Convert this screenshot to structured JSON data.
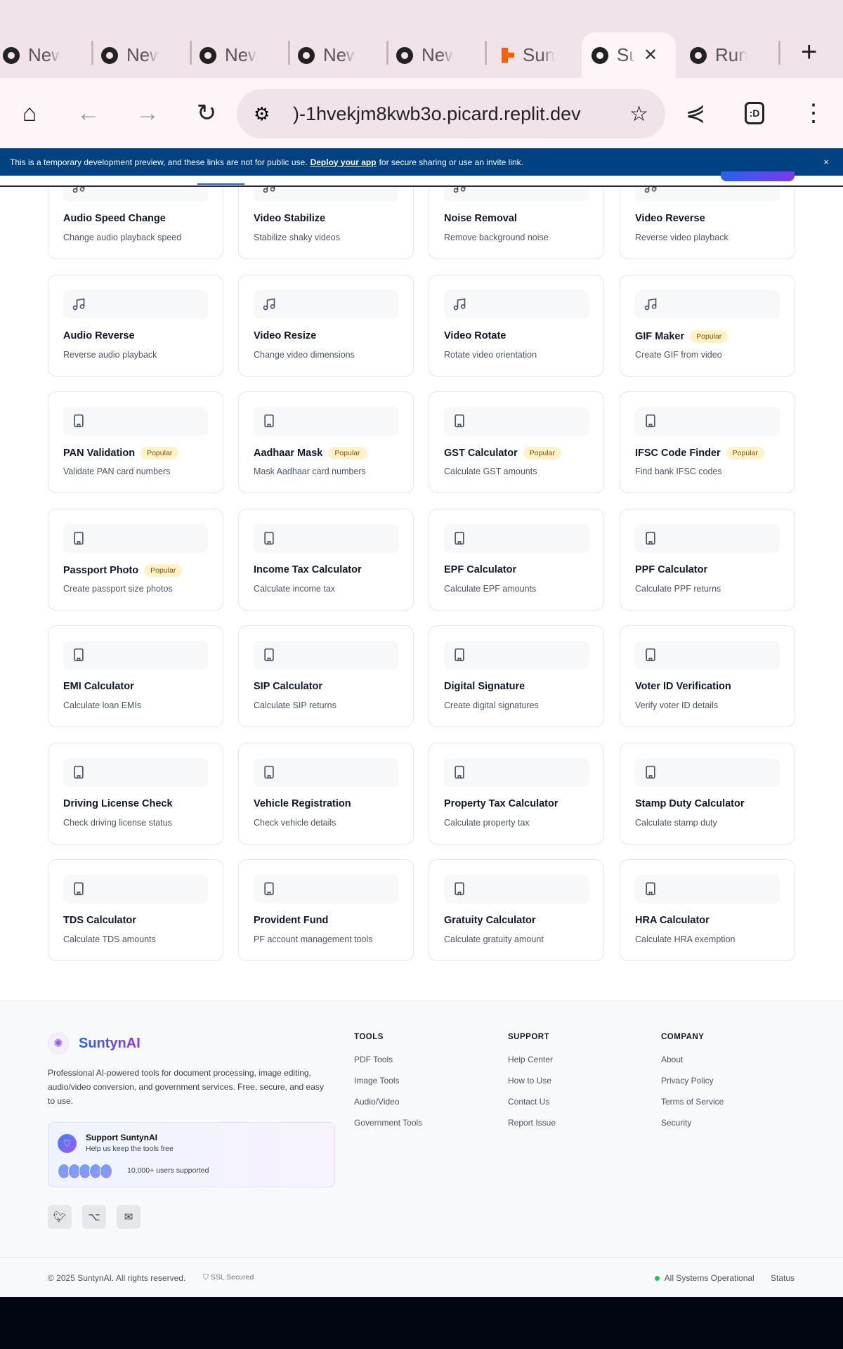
{
  "browser": {
    "tabs": [
      {
        "label": "New tab",
        "icon": "chrome-icon"
      },
      {
        "label": "New tab",
        "icon": "chrome-icon"
      },
      {
        "label": "New tab",
        "icon": "chrome-icon"
      },
      {
        "label": "New tab",
        "icon": "chrome-icon"
      },
      {
        "label": "New tab",
        "icon": "chrome-icon"
      },
      {
        "label": "Sunty",
        "icon": "replit-icon"
      },
      {
        "label": "Su",
        "icon": "globe-icon",
        "active": true
      },
      {
        "label": "Run t",
        "icon": "globe-icon"
      }
    ],
    "url": ")-1hvekjm8kwb3o.picard.replit.dev",
    "new_tab": "+"
  },
  "banner": {
    "text_before": "This is a temporary development preview, and these links are not for public use.",
    "link": "Deploy your app",
    "text_after": "for secure sharing or use an invite link.",
    "close": "×"
  },
  "tools": [
    {
      "title": "Audio Speed Change",
      "desc": "Change audio playback speed",
      "icon": "music"
    },
    {
      "title": "Video Stabilize",
      "desc": "Stabilize shaky videos",
      "icon": "music"
    },
    {
      "title": "Noise Removal",
      "desc": "Remove background noise",
      "icon": "music"
    },
    {
      "title": "Video Reverse",
      "desc": "Reverse video playback",
      "icon": "music"
    },
    {
      "title": "Audio Reverse",
      "desc": "Reverse audio playback",
      "icon": "music"
    },
    {
      "title": "Video Resize",
      "desc": "Change video dimensions",
      "icon": "music"
    },
    {
      "title": "Video Rotate",
      "desc": "Rotate video orientation",
      "icon": "music"
    },
    {
      "title": "GIF Maker",
      "desc": "Create GIF from video",
      "icon": "music",
      "badge": "Popular"
    },
    {
      "title": "PAN Validation",
      "desc": "Validate PAN card numbers",
      "icon": "building",
      "badge": "Popular"
    },
    {
      "title": "Aadhaar Mask",
      "desc": "Mask Aadhaar card numbers",
      "icon": "building",
      "badge": "Popular"
    },
    {
      "title": "GST Calculator",
      "desc": "Calculate GST amounts",
      "icon": "building",
      "badge": "Popular"
    },
    {
      "title": "IFSC Code Finder",
      "desc": "Find bank IFSC codes",
      "icon": "building",
      "badge": "Popular"
    },
    {
      "title": "Passport Photo",
      "desc": "Create passport size photos",
      "icon": "building",
      "badge": "Popular"
    },
    {
      "title": "Income Tax Calculator",
      "desc": "Calculate income tax",
      "icon": "building"
    },
    {
      "title": "EPF Calculator",
      "desc": "Calculate EPF amounts",
      "icon": "building"
    },
    {
      "title": "PPF Calculator",
      "desc": "Calculate PPF returns",
      "icon": "building"
    },
    {
      "title": "EMI Calculator",
      "desc": "Calculate loan EMIs",
      "icon": "building"
    },
    {
      "title": "SIP Calculator",
      "desc": "Calculate SIP returns",
      "icon": "building"
    },
    {
      "title": "Digital Signature",
      "desc": "Create digital signatures",
      "icon": "building"
    },
    {
      "title": "Voter ID Verification",
      "desc": "Verify voter ID details",
      "icon": "building"
    },
    {
      "title": "Driving License Check",
      "desc": "Check driving license status",
      "icon": "building"
    },
    {
      "title": "Vehicle Registration",
      "desc": "Check vehicle details",
      "icon": "building"
    },
    {
      "title": "Property Tax Calculator",
      "desc": "Calculate property tax",
      "icon": "building"
    },
    {
      "title": "Stamp Duty Calculator",
      "desc": "Calculate stamp duty",
      "icon": "building"
    },
    {
      "title": "TDS Calculator",
      "desc": "Calculate TDS amounts",
      "icon": "building"
    },
    {
      "title": "Provident Fund",
      "desc": "PF account management tools",
      "icon": "building"
    },
    {
      "title": "Gratuity Calculator",
      "desc": "Calculate gratuity amount",
      "icon": "building"
    },
    {
      "title": "HRA Calculator",
      "desc": "Calculate HRA exemption",
      "icon": "building"
    }
  ],
  "footer": {
    "brand": "SuntynAI",
    "description": "Professional AI-powered tools for document processing, image editing, audio/video conversion, and government services. Free, secure, and easy to use.",
    "support": {
      "title": "Support SuntynAI",
      "subtitle": "Help us keep the tools free",
      "count": "10,000+ users supported"
    },
    "columns": [
      {
        "heading": "TOOLS",
        "links": [
          "PDF Tools",
          "Image Tools",
          "Audio/Video",
          "Government Tools"
        ]
      },
      {
        "heading": "SUPPORT",
        "links": [
          "Help Center",
          "How to Use",
          "Contact Us",
          "Report Issue"
        ]
      },
      {
        "heading": "COMPANY",
        "links": [
          "About",
          "Privacy Policy",
          "Terms of Service",
          "Security"
        ]
      }
    ],
    "copyright": "© 2025 SuntynAI. All rights reserved.",
    "ssl": "SSL Secured",
    "status_text": "All Systems Operational",
    "status_link": "Status",
    "status_color": "#22c55e"
  }
}
